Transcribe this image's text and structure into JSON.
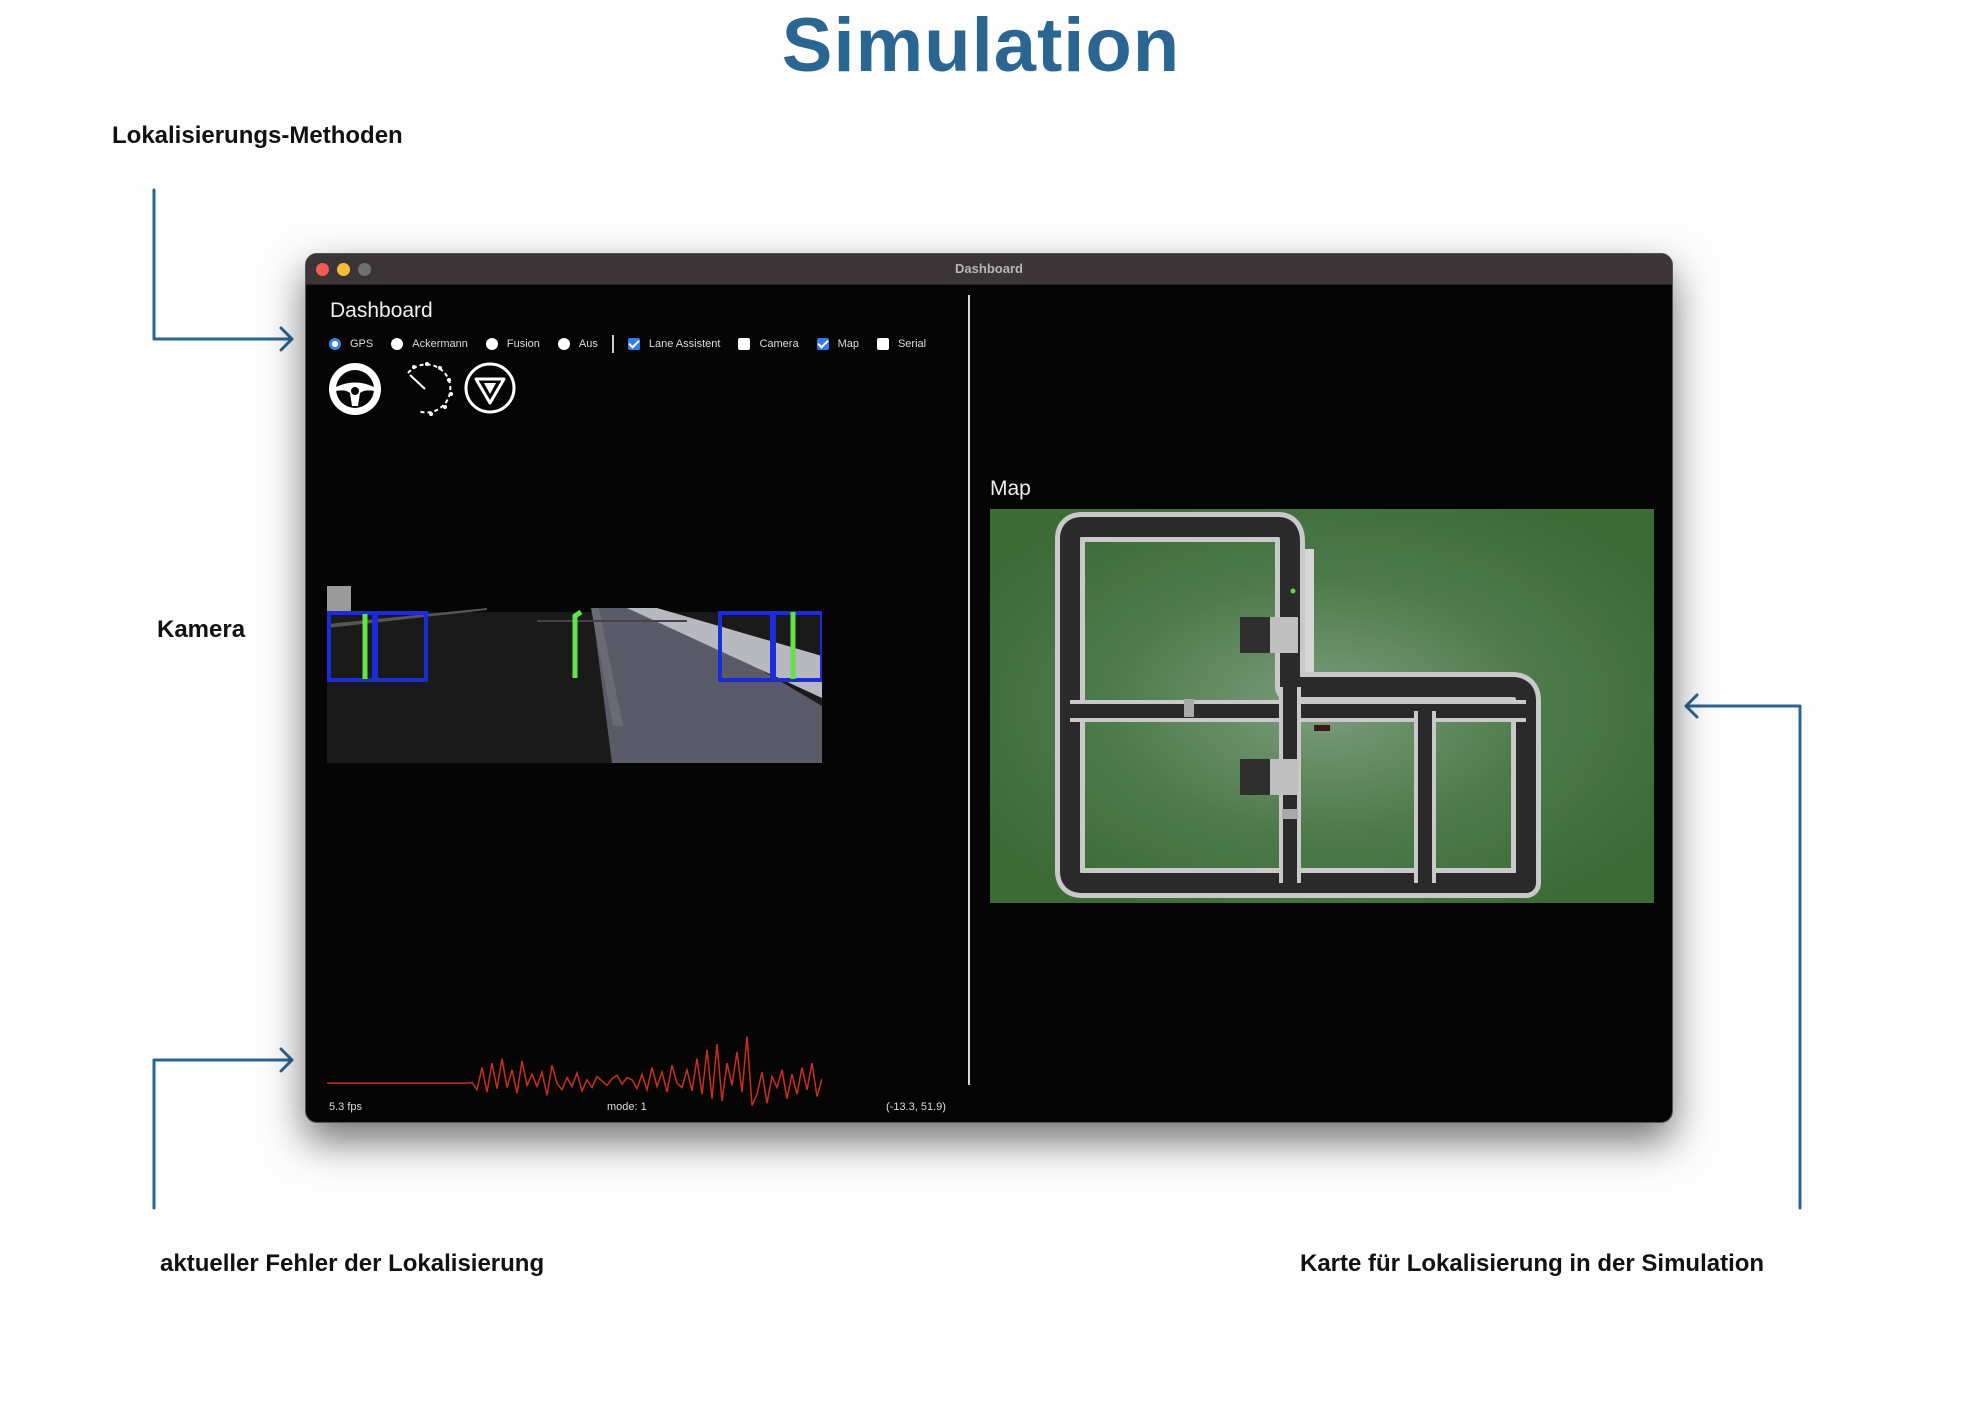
{
  "slide": {
    "title": "Simulation",
    "annotations": {
      "methods": "Lokalisierungs-Methoden",
      "camera": "Kamera",
      "error": "aktueller Fehler der Lokalisierung",
      "map": "Karte für Lokalisierung in der Simulation"
    },
    "arrow_color": "#2b6591"
  },
  "window": {
    "title": "Dashboard",
    "dashboard_title": "Dashboard",
    "map_title": "Map"
  },
  "controls": {
    "localization_methods": [
      {
        "label": "GPS",
        "selected": true
      },
      {
        "label": "Ackermann",
        "selected": false
      },
      {
        "label": "Fusion",
        "selected": false
      },
      {
        "label": "Aus",
        "selected": false
      }
    ],
    "toggles": [
      {
        "label": "Lane Assistent",
        "checked": true
      },
      {
        "label": "Camera",
        "checked": false
      },
      {
        "label": "Map",
        "checked": true
      },
      {
        "label": "Serial",
        "checked": false
      }
    ]
  },
  "gauges": [
    "steering-wheel-icon",
    "speedometer-icon",
    "heading-icon"
  ],
  "error_plot": {
    "color": "#c8301c",
    "values": [
      0,
      0,
      0,
      0,
      0,
      0,
      0,
      0,
      0,
      0,
      0,
      0,
      0,
      0,
      0,
      0,
      0,
      0,
      0,
      0,
      0,
      0,
      0,
      0,
      0,
      0,
      0,
      0,
      0,
      0.5,
      -6,
      14,
      -8,
      18,
      -5,
      22,
      -4,
      12,
      -9,
      20,
      -2,
      8,
      -3,
      10,
      -11,
      16,
      0,
      -6,
      5,
      -3,
      9,
      -7,
      3,
      -4,
      6,
      2,
      -2,
      4,
      7,
      -1,
      5,
      3,
      -5,
      8,
      -6,
      14,
      -3,
      10,
      -8,
      16,
      0,
      -4,
      12,
      -7,
      22,
      -10,
      30,
      -14,
      35,
      -16,
      18,
      -2,
      28,
      -8,
      42,
      -20,
      -10,
      10,
      -18,
      6,
      -4,
      12,
      -14,
      8,
      -10,
      14,
      -6,
      18,
      -12,
      4
    ],
    "min": -25,
    "max": 45
  },
  "status": {
    "fps": "5.3 fps",
    "mode": "mode: 1",
    "coords": "(-13.3, 51.9)"
  }
}
